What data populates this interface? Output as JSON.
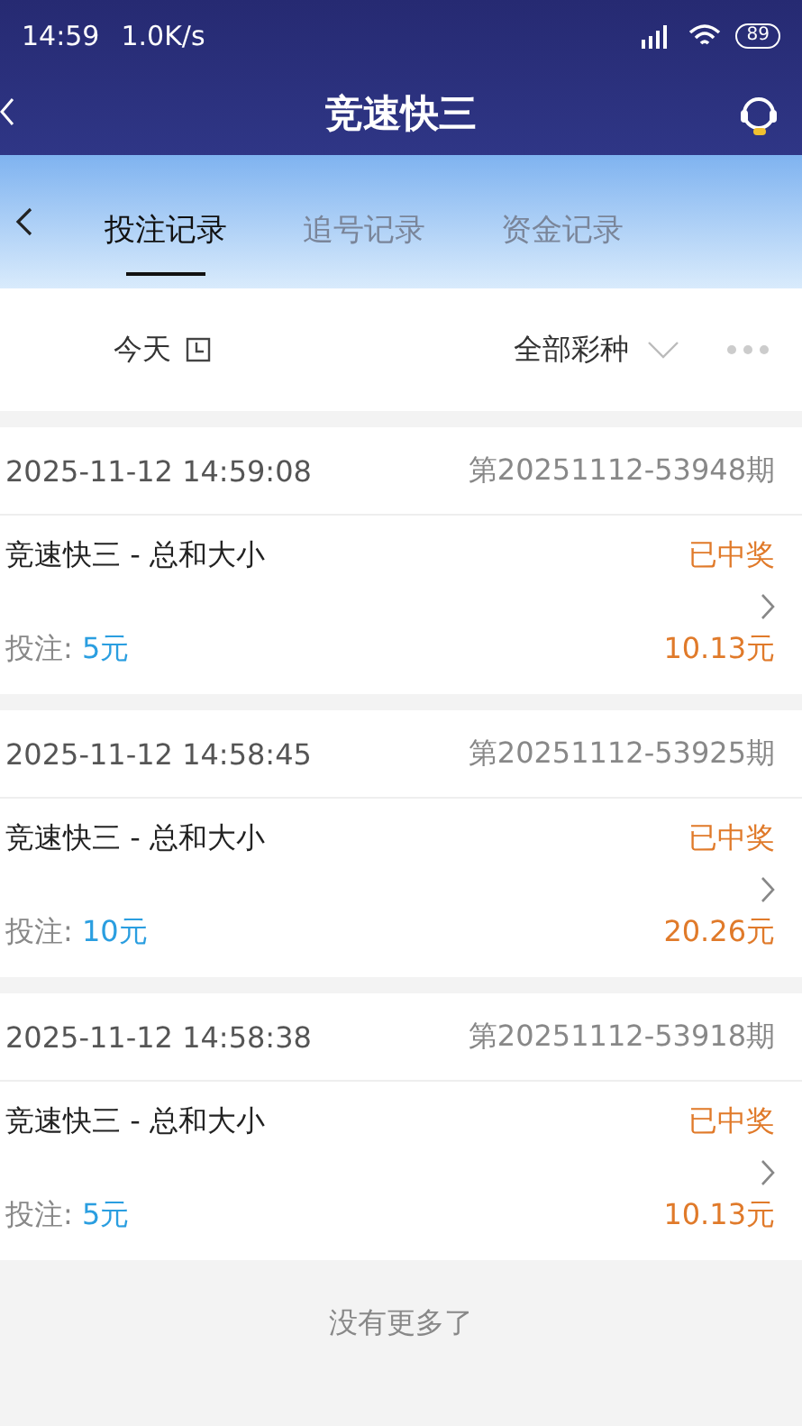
{
  "status_bar": {
    "time": "14:59",
    "speed": "1.0K/s",
    "battery": "89"
  },
  "header": {
    "title": "竞速快三"
  },
  "tabs": [
    {
      "label": "投注记录",
      "selected": true
    },
    {
      "label": "追号记录",
      "selected": false
    },
    {
      "label": "资金记录",
      "selected": false
    }
  ],
  "filters": {
    "date": "今天",
    "lottery": "全部彩种"
  },
  "records": [
    {
      "time": "2025-11-12 14:59:08",
      "issue": "第20251112-53948期",
      "game": "竞速快三 - 总和大小",
      "status": "已中奖",
      "bet_label": "投注:",
      "bet_amount": "5元",
      "prize": "10.13元"
    },
    {
      "time": "2025-11-12 14:58:45",
      "issue": "第20251112-53925期",
      "game": "竞速快三 - 总和大小",
      "status": "已中奖",
      "bet_label": "投注:",
      "bet_amount": "10元",
      "prize": "20.26元"
    },
    {
      "time": "2025-11-12 14:58:38",
      "issue": "第20251112-53918期",
      "game": "竞速快三 - 总和大小",
      "status": "已中奖",
      "bet_label": "投注:",
      "bet_amount": "5元",
      "prize": "10.13元"
    }
  ],
  "footer": "没有更多了"
}
